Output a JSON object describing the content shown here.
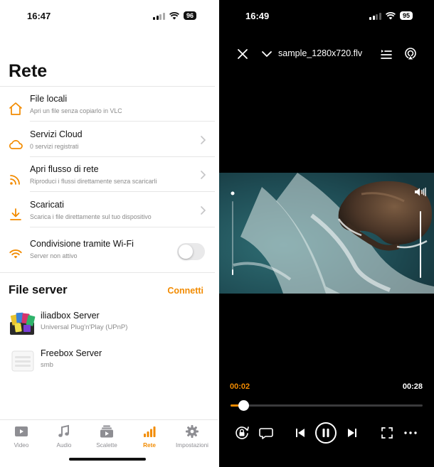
{
  "left_phone": {
    "status": {
      "time": "16:47",
      "battery": "96"
    },
    "title": "Rete",
    "menu": [
      {
        "icon": "home-icon",
        "title": "File locali",
        "subtitle": "Apri un file senza copiarlo in VLC"
      },
      {
        "icon": "cloud-icon",
        "title": "Servizi Cloud",
        "subtitle": "0 servizi registrati"
      },
      {
        "icon": "rss-icon",
        "title": "Apri flusso di rete",
        "subtitle": "Riproduci i flussi direttamente senza scaricarli"
      },
      {
        "icon": "download-icon",
        "title": "Scaricati",
        "subtitle": "Scarica i file direttamente sul tuo dispositivo"
      }
    ],
    "wifi_sharing": {
      "title": "Condivisione tramite Wi-Fi",
      "subtitle": "Server non attivo",
      "enabled": false
    },
    "file_server": {
      "heading": "File server",
      "connect_label": "Connetti",
      "servers": [
        {
          "name": "iliadbox Server",
          "protocol": "Universal Plug'n'Play (UPnP)"
        },
        {
          "name": "Freebox Server",
          "protocol": "smb"
        }
      ]
    },
    "tabs": [
      {
        "label": "Video",
        "icon": "video-icon"
      },
      {
        "label": "Audio",
        "icon": "music-note-icon"
      },
      {
        "label": "Scalette",
        "icon": "playlist-icon"
      },
      {
        "label": "Rete",
        "icon": "network-bars-icon",
        "active": true
      },
      {
        "label": "Impostazioni",
        "icon": "gear-icon"
      }
    ]
  },
  "right_phone": {
    "status": {
      "time": "16:49",
      "battery": "95"
    },
    "filename": "sample_1280x720.flv",
    "current_time": "00:02",
    "duration": "00:28",
    "progress": 0.07
  },
  "colors": {
    "accent": "#f28b00",
    "text": "#111111",
    "secondary": "#8a8a8a"
  }
}
